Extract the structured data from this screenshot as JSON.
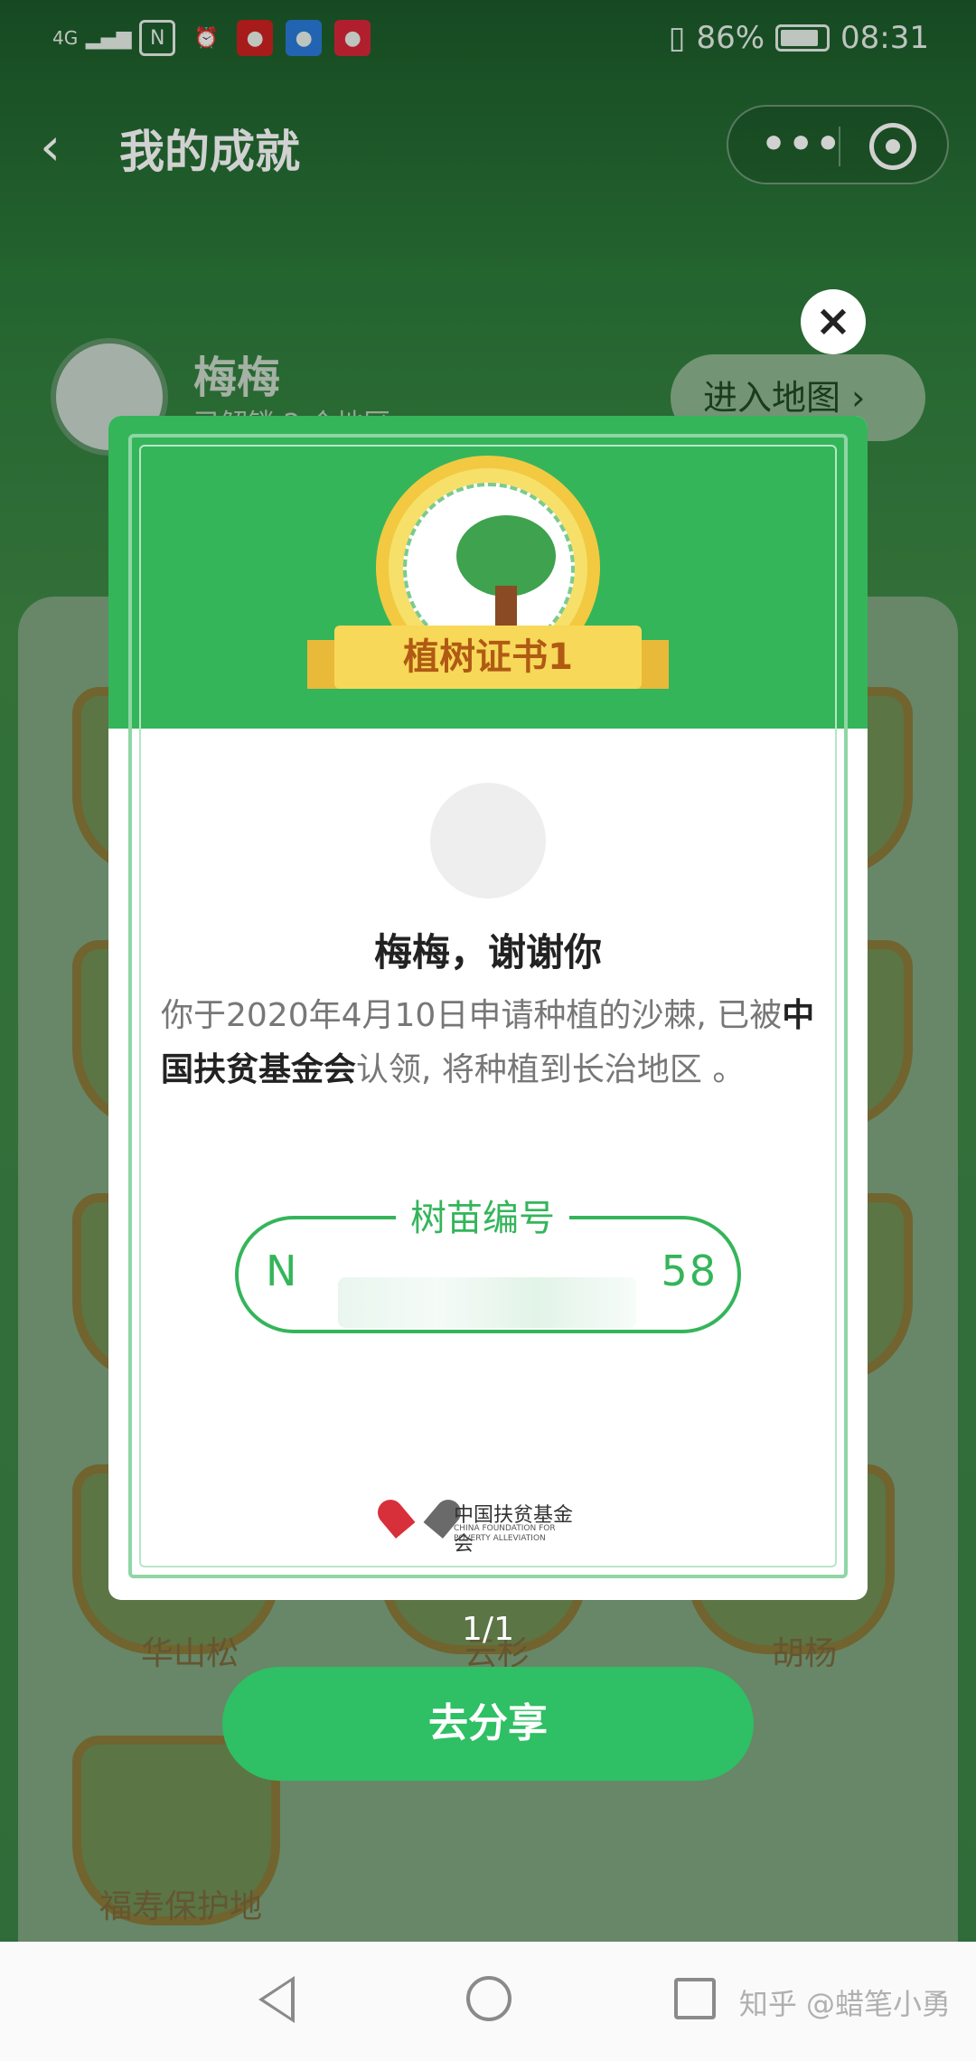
{
  "status_bar": {
    "network": "4G",
    "battery": "86%",
    "battery_fraction": 0.86,
    "time": "08:31"
  },
  "navbar": {
    "title": "我的成就",
    "back_icon": "chevron-left-icon",
    "more_icon": "more-dots-icon",
    "close_icon": "mini-program-close-icon"
  },
  "background": {
    "profile_name": "梅梅",
    "profile_sub": "已解锁 2 个地区",
    "map_button": "进入地图",
    "badges": [
      "华山松",
      "云杉",
      "胡杨",
      "福寿保护地"
    ]
  },
  "certificate": {
    "close_label": "×",
    "medal_title": "植树证书1",
    "thanks": "梅梅，谢谢你",
    "body_before": "你于2020年4月10日申请种植的沙棘, 已被",
    "organization": "中国扶贫基金会",
    "body_after": "认领, 将种植到长治地区 。",
    "sapling_label": "树苗编号",
    "sapling_number_prefix": "N",
    "sapling_number_suffix": "58",
    "logo_cn": "中国扶贫基金会",
    "logo_en": "CHINA FOUNDATION FOR POVERTY ALLEVIATION"
  },
  "pager": "1/1",
  "share_button": "去分享",
  "system_nav": {
    "back": "nav-back-icon",
    "home": "nav-home-icon",
    "recents": "nav-recents-icon"
  },
  "watermark": "知乎 @蜡笔小勇"
}
